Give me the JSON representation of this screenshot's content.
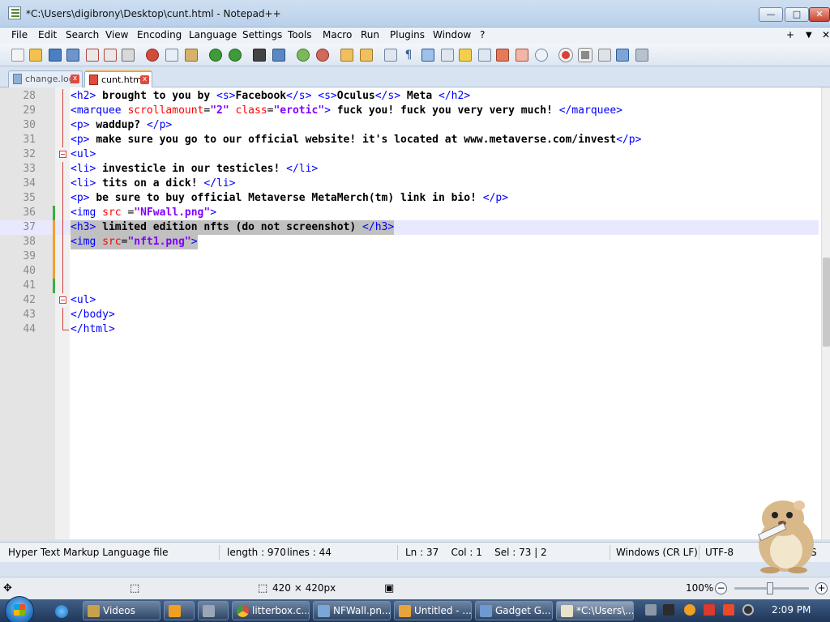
{
  "window": {
    "title": "*C:\\Users\\digibrony\\Desktop\\cunt.html - Notepad++",
    "minimize_label": "—",
    "maximize_label": "□",
    "close_label": "✕"
  },
  "menu": {
    "items": [
      "File",
      "Edit",
      "Search",
      "View",
      "Encoding",
      "Language",
      "Settings",
      "Tools",
      "Macro",
      "Run",
      "Plugins",
      "Window",
      "?"
    ],
    "right_plus": "+",
    "right_arrow": "▼",
    "right_close": "✕"
  },
  "tabs": [
    {
      "label": "change.log",
      "active": false
    },
    {
      "label": "cunt.html",
      "active": true
    }
  ],
  "editor": {
    "lines": [
      {
        "n": "28",
        "html": "<span class=\"tag\">&lt;h2&gt;</span> <span class=\"txt\">brought to you by</span> <span class=\"tag\">&lt;s&gt;</span><span class=\"txt\">Facebook</span><span class=\"tag\">&lt;/s&gt;</span> <span class=\"tag\">&lt;s&gt;</span><span class=\"txt\">Oculus</span><span class=\"tag\">&lt;/s&gt;</span> <span class=\"txt\">Meta</span> <span class=\"tag\">&lt;/h2&gt;</span>"
      },
      {
        "n": "29",
        "html": "<span class=\"tag\">&lt;marquee</span> <span class=\"attr\">scrollamount</span>=<span class=\"str\">\"2\"</span> <span class=\"attr\">class</span>=<span class=\"str\">\"erotic\"</span><span class=\"tag\">&gt;</span> <span class=\"txt\">fuck you! fuck you very very much!</span> <span class=\"tag\">&lt;/marquee&gt;</span>"
      },
      {
        "n": "30",
        "html": "<span class=\"tag\">&lt;p&gt;</span> <span class=\"txt\">waddup?</span> <span class=\"tag\">&lt;/p&gt;</span>"
      },
      {
        "n": "31",
        "html": "<span class=\"tag\">&lt;p&gt;</span> <span class=\"txt\">make sure you go to our official website! it's located at www.metaverse.com/invest</span><span class=\"tag\">&lt;/p&gt;</span>"
      },
      {
        "n": "32",
        "html": "<span class=\"tag\">&lt;ul&gt;</span>"
      },
      {
        "n": "33",
        "html": "<span class=\"tag\">&lt;li&gt;</span> <span class=\"txt\">investicle in our testicles!</span> <span class=\"tag\">&lt;/li&gt;</span>"
      },
      {
        "n": "34",
        "html": "<span class=\"tag\">&lt;li&gt;</span> <span class=\"txt\">tits on a dick!</span> <span class=\"tag\">&lt;/li&gt;</span>"
      },
      {
        "n": "35",
        "html": "<span class=\"tag\">&lt;p&gt;</span> <span class=\"txt\">be sure to buy official Metaverse MetaMerch(tm) link in bio!</span> <span class=\"tag\">&lt;/p&gt;</span>"
      },
      {
        "n": "36",
        "html": "<span class=\"tag\">&lt;img</span> <span class=\"attr\">src</span> =<span class=\"str\">\"NFwall.png\"</span><span class=\"tag\">&gt;</span>"
      },
      {
        "n": "37",
        "html": "<span class=\"tag\">&lt;h3&gt;</span> <span class=\"txt\">limited edition nfts (do not screenshot)</span> <span class=\"tag\">&lt;/h3&gt;</span>"
      },
      {
        "n": "38",
        "html": "<span class=\"tag\">&lt;img</span> <span class=\"attr\">src</span>=<span class=\"str\">\"nft1.png\"</span><span class=\"tag\">&gt;</span>"
      },
      {
        "n": "39",
        "html": ""
      },
      {
        "n": "40",
        "html": ""
      },
      {
        "n": "41",
        "html": ""
      },
      {
        "n": "42",
        "html": "<span class=\"tag\">&lt;ul&gt;</span>"
      },
      {
        "n": "43",
        "html": "<span class=\"tag\">&lt;/body&gt;</span>"
      },
      {
        "n": "44",
        "html": "<span class=\"tag\">&lt;/html&gt;</span>"
      }
    ]
  },
  "status": {
    "file_type": "Hyper Text Markup Language file",
    "length": "length : 970",
    "lines": "lines : 44",
    "position": "Ln : 37    Col : 1    Sel : 73 | 2",
    "eol": "Windows (CR LF)",
    "encoding": "UTF-8",
    "ins": "S"
  },
  "viewer": {
    "dimensions": "420 × 420px",
    "zoom": "100%",
    "zoom_minus": "−",
    "zoom_plus": "+"
  },
  "taskbar": {
    "tasks": [
      {
        "label": "Videos",
        "color": "#c8a24a"
      },
      {
        "label": "",
        "color": "#f0a020"
      },
      {
        "label": "",
        "color": "#9aa6b5"
      },
      {
        "label": "litterbox.c...",
        "color": "#d84b37"
      },
      {
        "label": "NFWall.pn...",
        "color": "#7aa7d8"
      },
      {
        "label": "Untitled - ...",
        "color": "#e7a33c"
      },
      {
        "label": "Gadget G...",
        "color": "#6d9ad0"
      },
      {
        "label": "*C:\\Users\\...",
        "color": "#e8e2c8"
      }
    ],
    "clock": "2:09 PM"
  },
  "colors": {
    "tag": "#0000ff",
    "attribute": "#ff0000",
    "string": "#8000ff",
    "selection": "#c0c0c0",
    "tab_accent": "#f2a230"
  }
}
